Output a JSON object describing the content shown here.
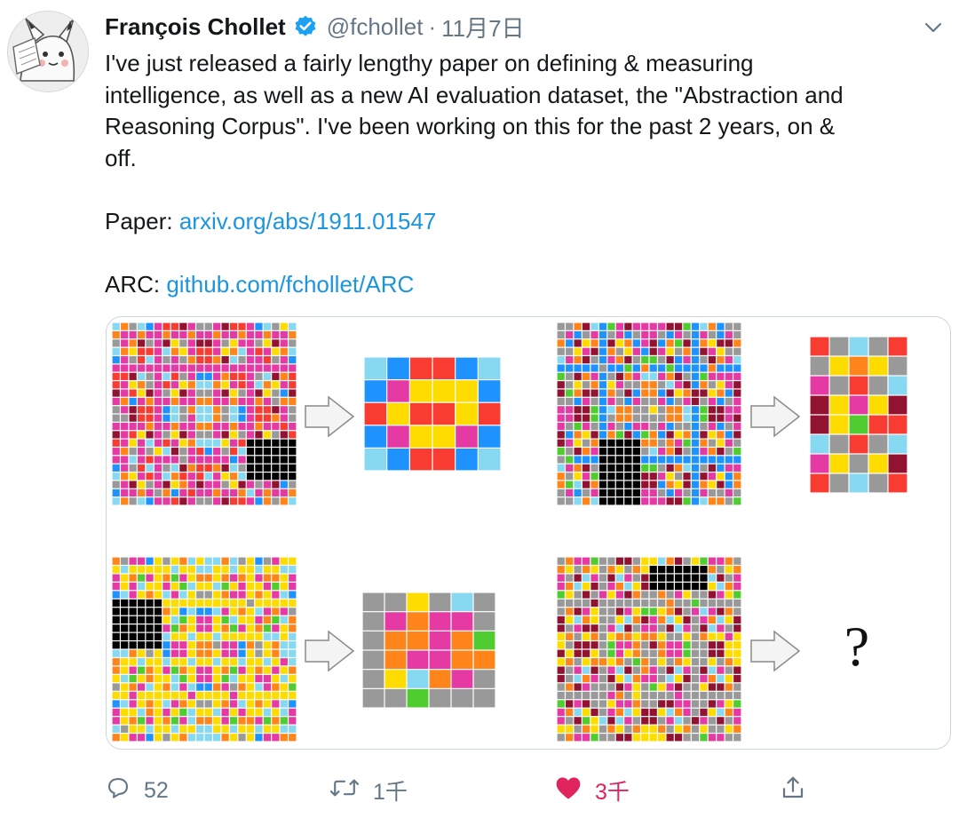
{
  "tweet": {
    "author_name": "François Chollet",
    "handle": "@fchollet",
    "separator": "·",
    "date": "11月7日",
    "body": {
      "line1": "I've just released a fairly lengthy paper on defining & measuring",
      "line2": "intelligence, as well as a new AI evaluation dataset, the \"Abstraction and",
      "line3": "Reasoning Corpus\". I've been working on this for the past 2 years, on &",
      "line4": "off.",
      "paper_label": "Paper: ",
      "paper_link": "arxiv.org/abs/1911.01547",
      "arc_label": "ARC: ",
      "arc_link": "github.com/fchollet/ARC"
    },
    "media": {
      "question_mark": "?"
    },
    "actions": {
      "reply_count": "52",
      "retweet_count": "1千",
      "like_count": "3千",
      "liked": true
    }
  },
  "icons": [
    "verified-badge-icon",
    "chevron-down-icon",
    "reply-icon",
    "retweet-icon",
    "heart-icon",
    "share-icon",
    "arrow-right-icon"
  ],
  "colors": {
    "link": "#1b95e0",
    "verified": "#1da1f2",
    "muted": "#657786",
    "like": "#e0245e",
    "arc_palette": [
      "#000000",
      "#1e93ff",
      "#f93c31",
      "#4fcc30",
      "#ffdc00",
      "#999999",
      "#e53aa3",
      "#ff851b",
      "#87d8f1",
      "#921231"
    ]
  }
}
